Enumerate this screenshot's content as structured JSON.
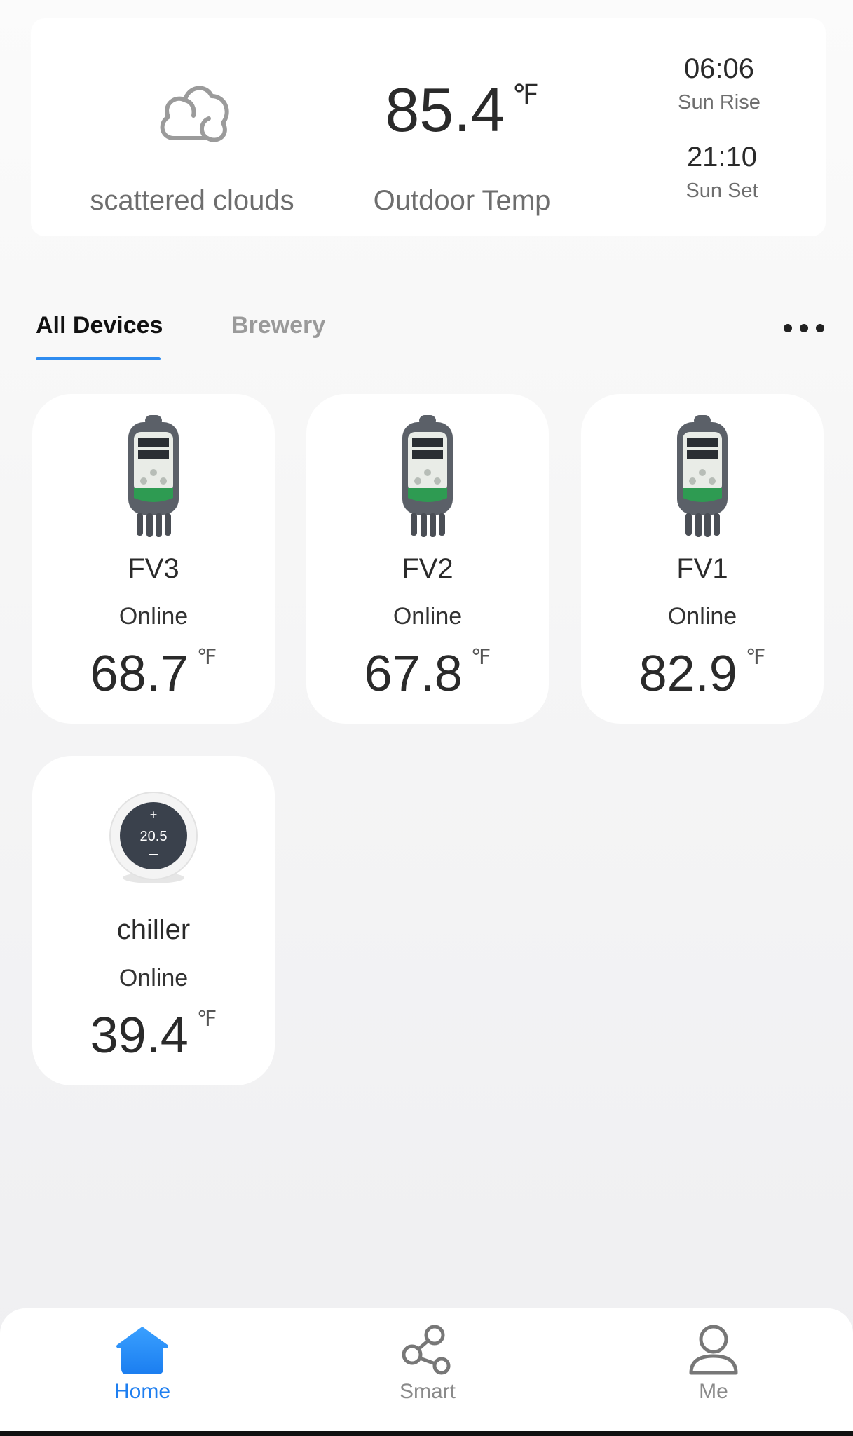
{
  "weather": {
    "condition": "scattered clouds",
    "icon": "cloud-icon",
    "outdoor_temp": "85.4",
    "outdoor_unit": "℉",
    "outdoor_label": "Outdoor Temp",
    "sunrise_time": "06:06",
    "sunrise_label": "Sun Rise",
    "sunset_time": "21:10",
    "sunset_label": "Sun Set"
  },
  "tabs": [
    {
      "label": "All Devices",
      "active": true
    },
    {
      "label": "Brewery",
      "active": false
    }
  ],
  "more_icon": "more-horizontal-icon",
  "accent_color": "#2f8cf0",
  "devices": [
    {
      "name": "FV3",
      "status": "Online",
      "temp": "68.7",
      "unit": "℉",
      "icon": "temperature-controller-icon"
    },
    {
      "name": "FV2",
      "status": "Online",
      "temp": "67.8",
      "unit": "℉",
      "icon": "temperature-controller-icon"
    },
    {
      "name": "FV1",
      "status": "Online",
      "temp": "82.9",
      "unit": "℉",
      "icon": "temperature-controller-icon"
    },
    {
      "name": "chiller",
      "status": "Online",
      "temp": "39.4",
      "unit": "℉",
      "icon": "thermostat-dial-icon",
      "dial_value": "20.5"
    }
  ],
  "nav": [
    {
      "label": "Home",
      "icon": "home-icon",
      "active": true
    },
    {
      "label": "Smart",
      "icon": "share-nodes-icon",
      "active": false
    },
    {
      "label": "Me",
      "icon": "person-icon",
      "active": false
    }
  ]
}
